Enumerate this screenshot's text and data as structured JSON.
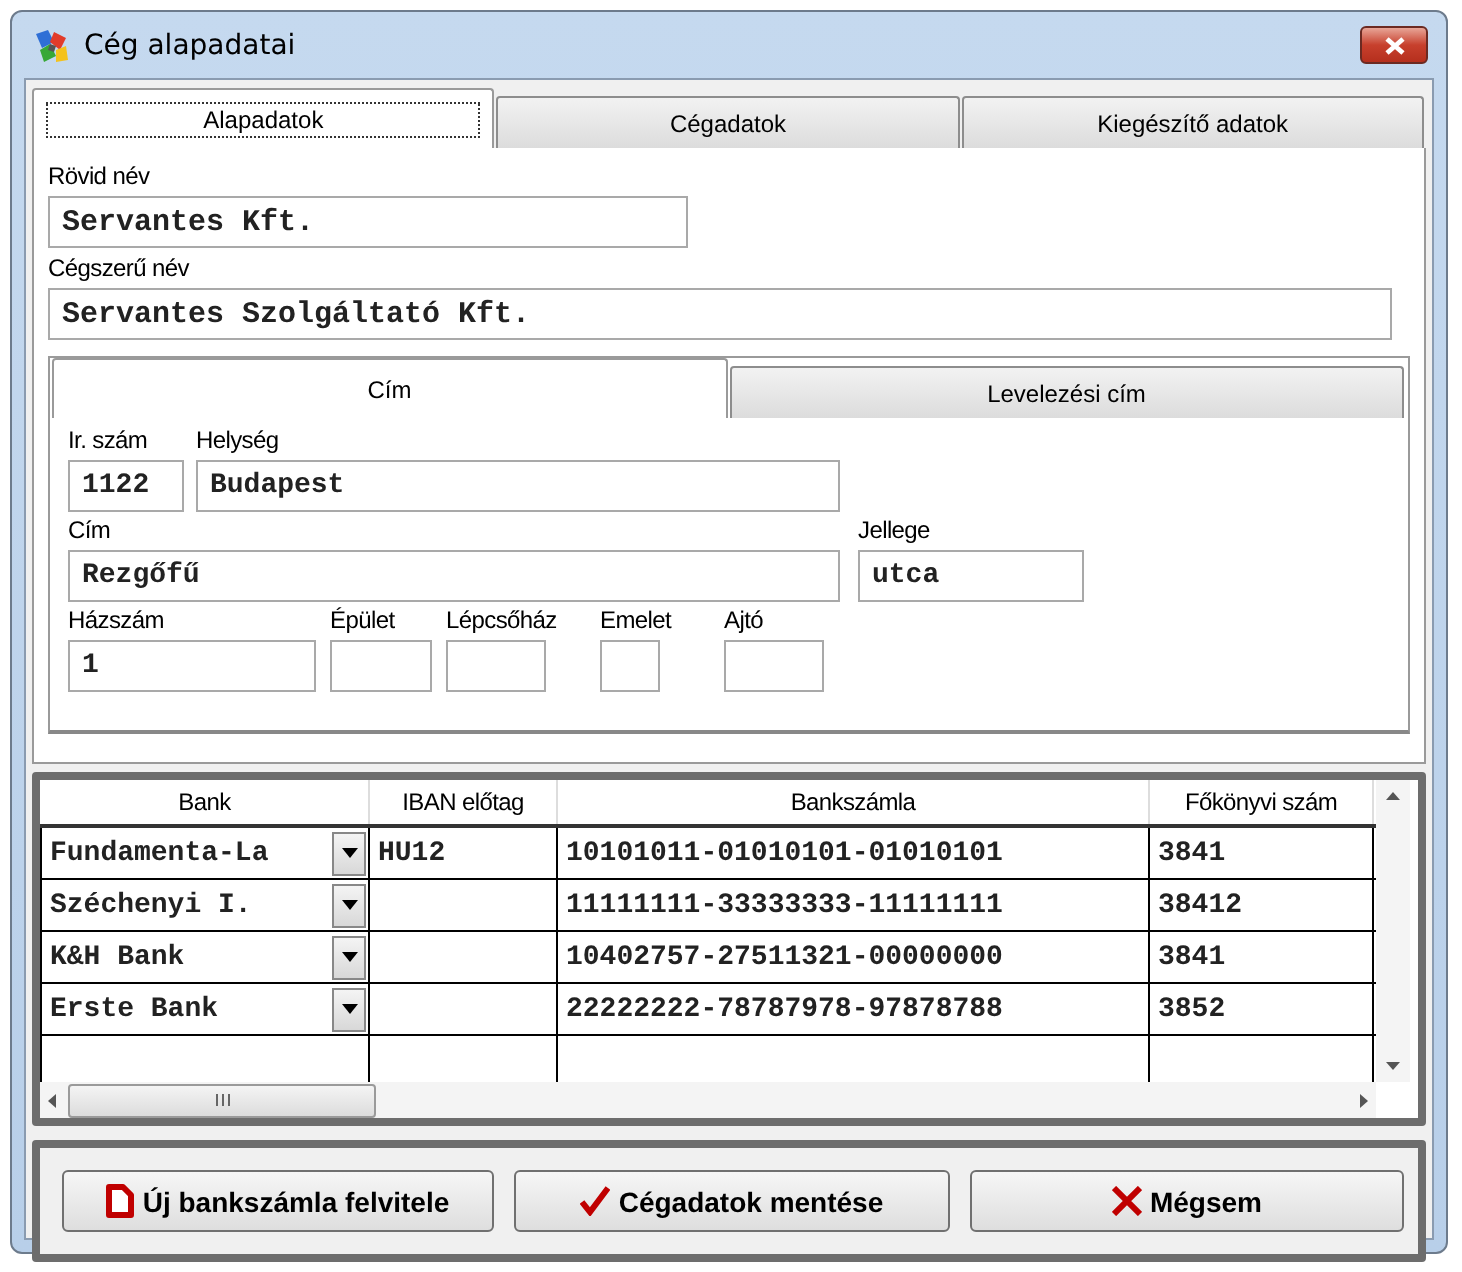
{
  "window": {
    "title": "Cég alapadatai"
  },
  "tabs": [
    {
      "label": "Alapadatok",
      "selected": true
    },
    {
      "label": "Cégadatok",
      "selected": false
    },
    {
      "label": "Kiegészítő adatok",
      "selected": false
    }
  ],
  "fields": [
    {
      "label": "Rövid név",
      "value": "Servantes Kft."
    },
    {
      "label": "Cégszerű név",
      "value": "Servantes Szolgáltató Kft."
    }
  ],
  "address_tabs": [
    {
      "label": "Cím",
      "selected": true
    },
    {
      "label": "Levelezési cím",
      "selected": false
    }
  ],
  "address_fields": [
    {
      "label": "Ir. szám",
      "value": "1122"
    },
    {
      "label": "Helység",
      "value": "Budapest"
    },
    {
      "label": "Cím",
      "value": "Rezgőfű"
    },
    {
      "label": "Jellege",
      "value": "utca"
    },
    {
      "label": "Házszám",
      "value": "1"
    },
    {
      "label": "Épület"
    },
    {
      "label": "Lépcsőház"
    },
    {
      "label": "Emelet"
    },
    {
      "label": "Ajtó"
    }
  ],
  "bank_table": {
    "columns": [
      "Bank",
      "IBAN előtag",
      "Bankszámla",
      "Főkönyvi szám"
    ],
    "rows": [
      {
        "bank": "Fundamenta-La",
        "iban": "HU12",
        "account": "10101011-01010101-01010101",
        "ledger": "3841"
      },
      {
        "bank": "Széchenyi I.",
        "account": "11111111-33333333-11111111",
        "ledger": "38412"
      },
      {
        "bank": "K&H Bank",
        "account": "10402757-27511321-00000000",
        "ledger": "3841"
      },
      {
        "bank": "Erste Bank",
        "account": "22222222-78787978-97878788",
        "ledger": "3852"
      }
    ]
  },
  "buttons": [
    {
      "label": "Új bankszámla felvitele",
      "kind": "new"
    },
    {
      "label": "Cégadatok mentése",
      "kind": "save"
    },
    {
      "label": "Mégsem",
      "kind": "cancel"
    }
  ]
}
